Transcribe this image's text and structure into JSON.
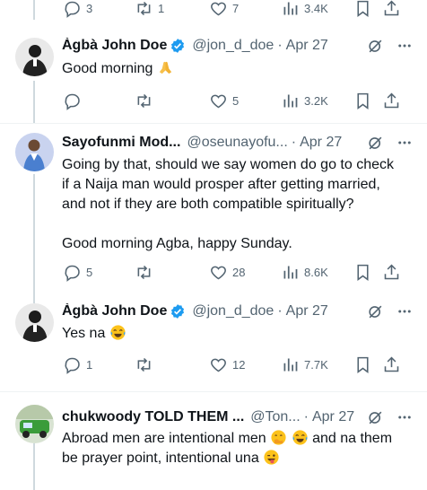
{
  "top_actions": {
    "reply": "3",
    "retweet": "1",
    "like": "7",
    "views": "3.4K"
  },
  "tweets": [
    {
      "name": "Àgbà John Doe",
      "handle": "@jon_d_doe",
      "date": "Apr 27",
      "text": [
        "Good morning"
      ],
      "text_emoji": "folded-hands-emoji",
      "actions": {
        "reply": "",
        "retweet": "",
        "like": "5",
        "views": "3.2K"
      }
    },
    {
      "name": "Sayofunmi Mod...",
      "handle": "@oseunayofu...",
      "date": "Apr 27",
      "text": [
        "Going by that, should we say women do go to check",
        "if a Naija man would prosper after getting married,",
        "and not if they are both compatible spiritually?",
        "Good morning Agba, happy Sunday."
      ],
      "actions": {
        "reply": "5",
        "retweet": "",
        "like": "28",
        "views": "8.6K"
      }
    },
    {
      "name": "Àgbà John Doe",
      "handle": "@jon_d_doe",
      "date": "Apr 27",
      "text": [
        "Yes na"
      ],
      "text_emoji": "tears-of-joy-emoji",
      "actions": {
        "reply": "1",
        "retweet": "",
        "like": "12",
        "views": "7.7K"
      }
    },
    {
      "name": "chukwoody TOLD THEM ...",
      "handle": "@Ton...",
      "date": "Apr 27",
      "text": [
        "Abroad men are intentional men",
        "and na them",
        "be prayer point, intentional una"
      ],
      "actions": {}
    }
  ],
  "colors": {
    "text": "#0f1419",
    "muted": "#536471",
    "verified": "#1d9bf0",
    "divider": "#eff3f4",
    "thread": "#cfd9de"
  }
}
